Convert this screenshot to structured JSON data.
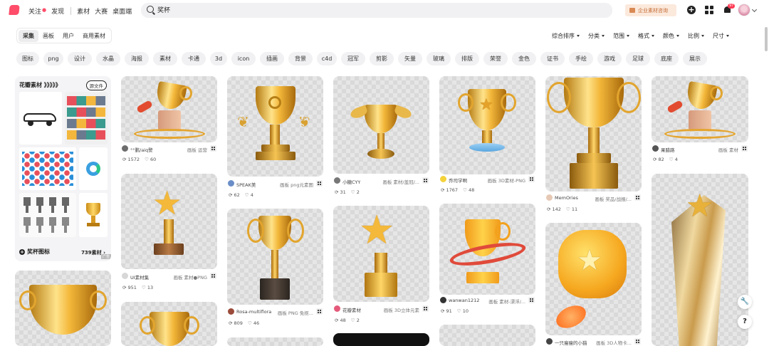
{
  "header": {
    "nav": [
      "关注",
      "发现",
      "素材",
      "大赛",
      "桌面端"
    ],
    "search_value": "奖杯",
    "enterprise_label": "企业素材咨询",
    "notification_count": "97"
  },
  "tabs": [
    "采集",
    "画板",
    "用户",
    "商用素材"
  ],
  "active_tab": "采集",
  "filters": [
    "综合排序",
    "分类",
    "范围",
    "格式",
    "颜色",
    "比例",
    "尺寸"
  ],
  "chips": [
    "图标",
    "png",
    "设计",
    "水晶",
    "海报",
    "素材",
    "卡通",
    "3d",
    "icon",
    "插画",
    "背景",
    "c4d",
    "冠军",
    "剪影",
    "矢量",
    "玻璃",
    "排版",
    "荣誉",
    "金色",
    "证书",
    "手绘",
    "游戏",
    "足球",
    "底座",
    "展示"
  ],
  "collage": {
    "title": "花瓣素材 》》》》》",
    "source_button": "源文件",
    "footer_title": "奖杯图标",
    "count": "739素材 ›",
    "tag": "广告"
  },
  "cards": [
    {
      "author": "°°鹏/aiq警",
      "board": "画板 运营",
      "reposts": "1572",
      "likes": "60"
    },
    {
      "author": "UI素材集",
      "board": "画板 素材●PNG",
      "reposts": "951",
      "likes": "13"
    },
    {
      "author": "SPEAK美",
      "board": "画板 png元素图",
      "reposts": "62",
      "likes": "4"
    },
    {
      "author": "Rosa-multiflora",
      "board": "画板 PNG 免抠...",
      "reposts": "809",
      "likes": "46"
    },
    {
      "author": "小糖CYY",
      "board": "画板 素材/盖冠/...",
      "reposts": "31",
      "likes": "2"
    },
    {
      "author": "花瓣素材",
      "board": "画板 3D立体元素",
      "reposts": "48",
      "likes": "2"
    },
    {
      "author": "乔司学啊",
      "board": "画板 3D素材-PNG",
      "reposts": "1767",
      "likes": "48"
    },
    {
      "author": "wanwan1212",
      "board": "画板 素材-漂浮/...",
      "reposts": "91",
      "likes": "10"
    },
    {
      "author": "MemOries",
      "board": "画板 奖品/战报/...",
      "reposts": "142",
      "likes": "11"
    },
    {
      "author": "一只瘦瘦的小猫",
      "board": "画板 3D人物卡...",
      "reposts": "",
      "likes": ""
    },
    {
      "author": "果腊路",
      "board": "画板 素材",
      "reposts": "82",
      "likes": "4"
    }
  ],
  "float_buttons": [
    "wrench",
    "?"
  ]
}
